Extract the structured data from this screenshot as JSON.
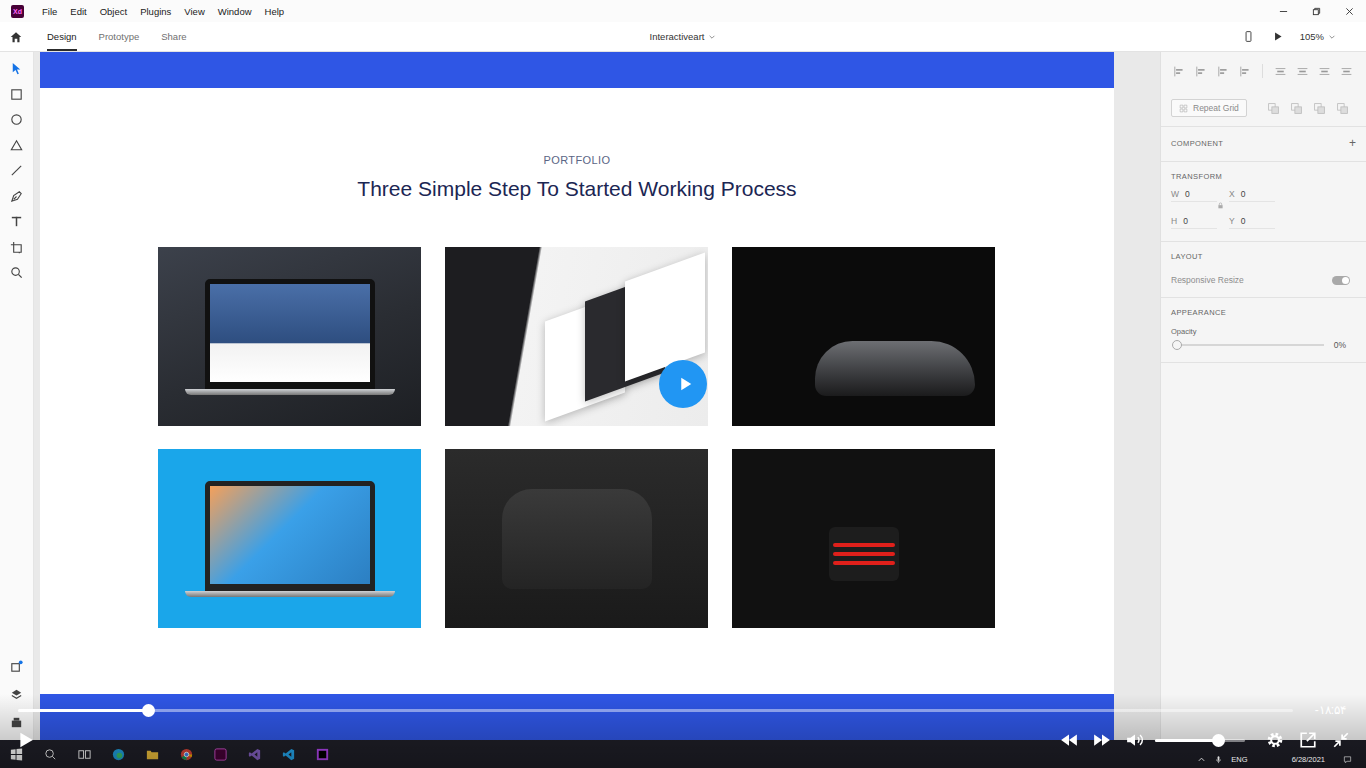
{
  "app": {
    "logo": "Xd"
  },
  "menu": [
    "File",
    "Edit",
    "Object",
    "Plugins",
    "View",
    "Window",
    "Help"
  ],
  "tabs": [
    {
      "label": "Design",
      "selected": true
    },
    {
      "label": "Prototype",
      "selected": false
    },
    {
      "label": "Share",
      "selected": false
    }
  ],
  "document": {
    "title": "Interactiveart",
    "zoom": "105%"
  },
  "artboard": {
    "eyebrow": "PORTFOLIO",
    "heading": "Three Simple Step To Started Working Process",
    "cards": [
      {
        "kind": "laptop"
      },
      {
        "kind": "showcase"
      },
      {
        "kind": "car"
      },
      {
        "kind": "skype"
      },
      {
        "kind": "van"
      },
      {
        "kind": "product"
      }
    ]
  },
  "inspector": {
    "repeat_grid": {
      "label": "Repeat Grid",
      "disabled": true
    },
    "component": {
      "label": "COMPONENT",
      "add": "+"
    },
    "transform": {
      "label": "TRANSFORM",
      "fields": [
        {
          "label": "W",
          "value": "0"
        },
        {
          "label": "X",
          "value": "0"
        },
        {
          "label": "H",
          "value": "0"
        },
        {
          "label": "Y",
          "value": "0"
        }
      ]
    },
    "layout": {
      "label": "LAYOUT",
      "responsive": {
        "label": "Responsive Resize",
        "on": true,
        "disabled": true
      }
    },
    "appearance": {
      "label": "APPEARANCE",
      "opacity": {
        "label": "Opacity",
        "level": 0,
        "reading": "0%"
      }
    }
  },
  "player": {
    "progress": 0.102,
    "time": "-۱۸:۵۴",
    "volume": 0.7
  },
  "taskbar": {
    "language": "ENG",
    "date": "6/28/2021"
  }
}
